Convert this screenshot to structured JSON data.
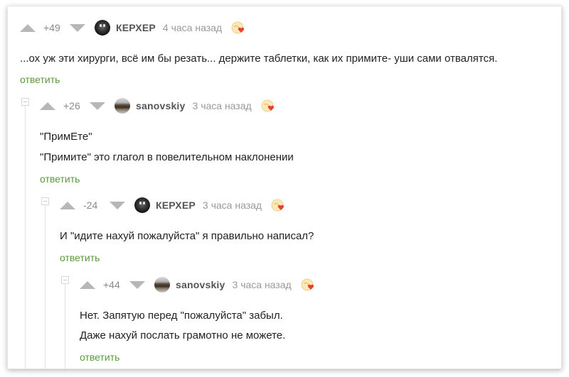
{
  "comments": [
    {
      "rating": "+49",
      "author": "КЕРХЕР",
      "time": "4 часа назад",
      "lines": [
        "...ох уж эти хирурги, всё им бы резать... держите таблетки, как их примите- уши сами отвалятся."
      ],
      "reply_label": "ответить",
      "avatar": "dark-skull-avatar"
    },
    {
      "rating": "+26",
      "author": "sanovskiy",
      "time": "3 часа назад",
      "lines": [
        "\"ПримЕте\"",
        "\"Примите\" это глагол в повелительном наклонении"
      ],
      "reply_label": "ответить",
      "avatar": "car-avatar"
    },
    {
      "rating": "-24",
      "author": "КЕРХЕР",
      "time": "3 часа назад",
      "lines": [
        "И \"идите нахуй пожалуйста\" я правильно написал?"
      ],
      "reply_label": "ответить",
      "avatar": "dark-skull-avatar"
    },
    {
      "rating": "+44",
      "author": "sanovskiy",
      "time": "3 часа назад",
      "lines": [
        "Нет. Запятую перед \"пожалуйста\" забыл.",
        "Даже нахуй послать грамотно не можете."
      ],
      "reply_label": "ответить",
      "avatar": "car-avatar"
    }
  ],
  "colors": {
    "reply_link": "#5a9a3c",
    "arrows": "#b7b7b7",
    "username": "#555555",
    "meta": "#999999",
    "heart": "#e0462f"
  }
}
